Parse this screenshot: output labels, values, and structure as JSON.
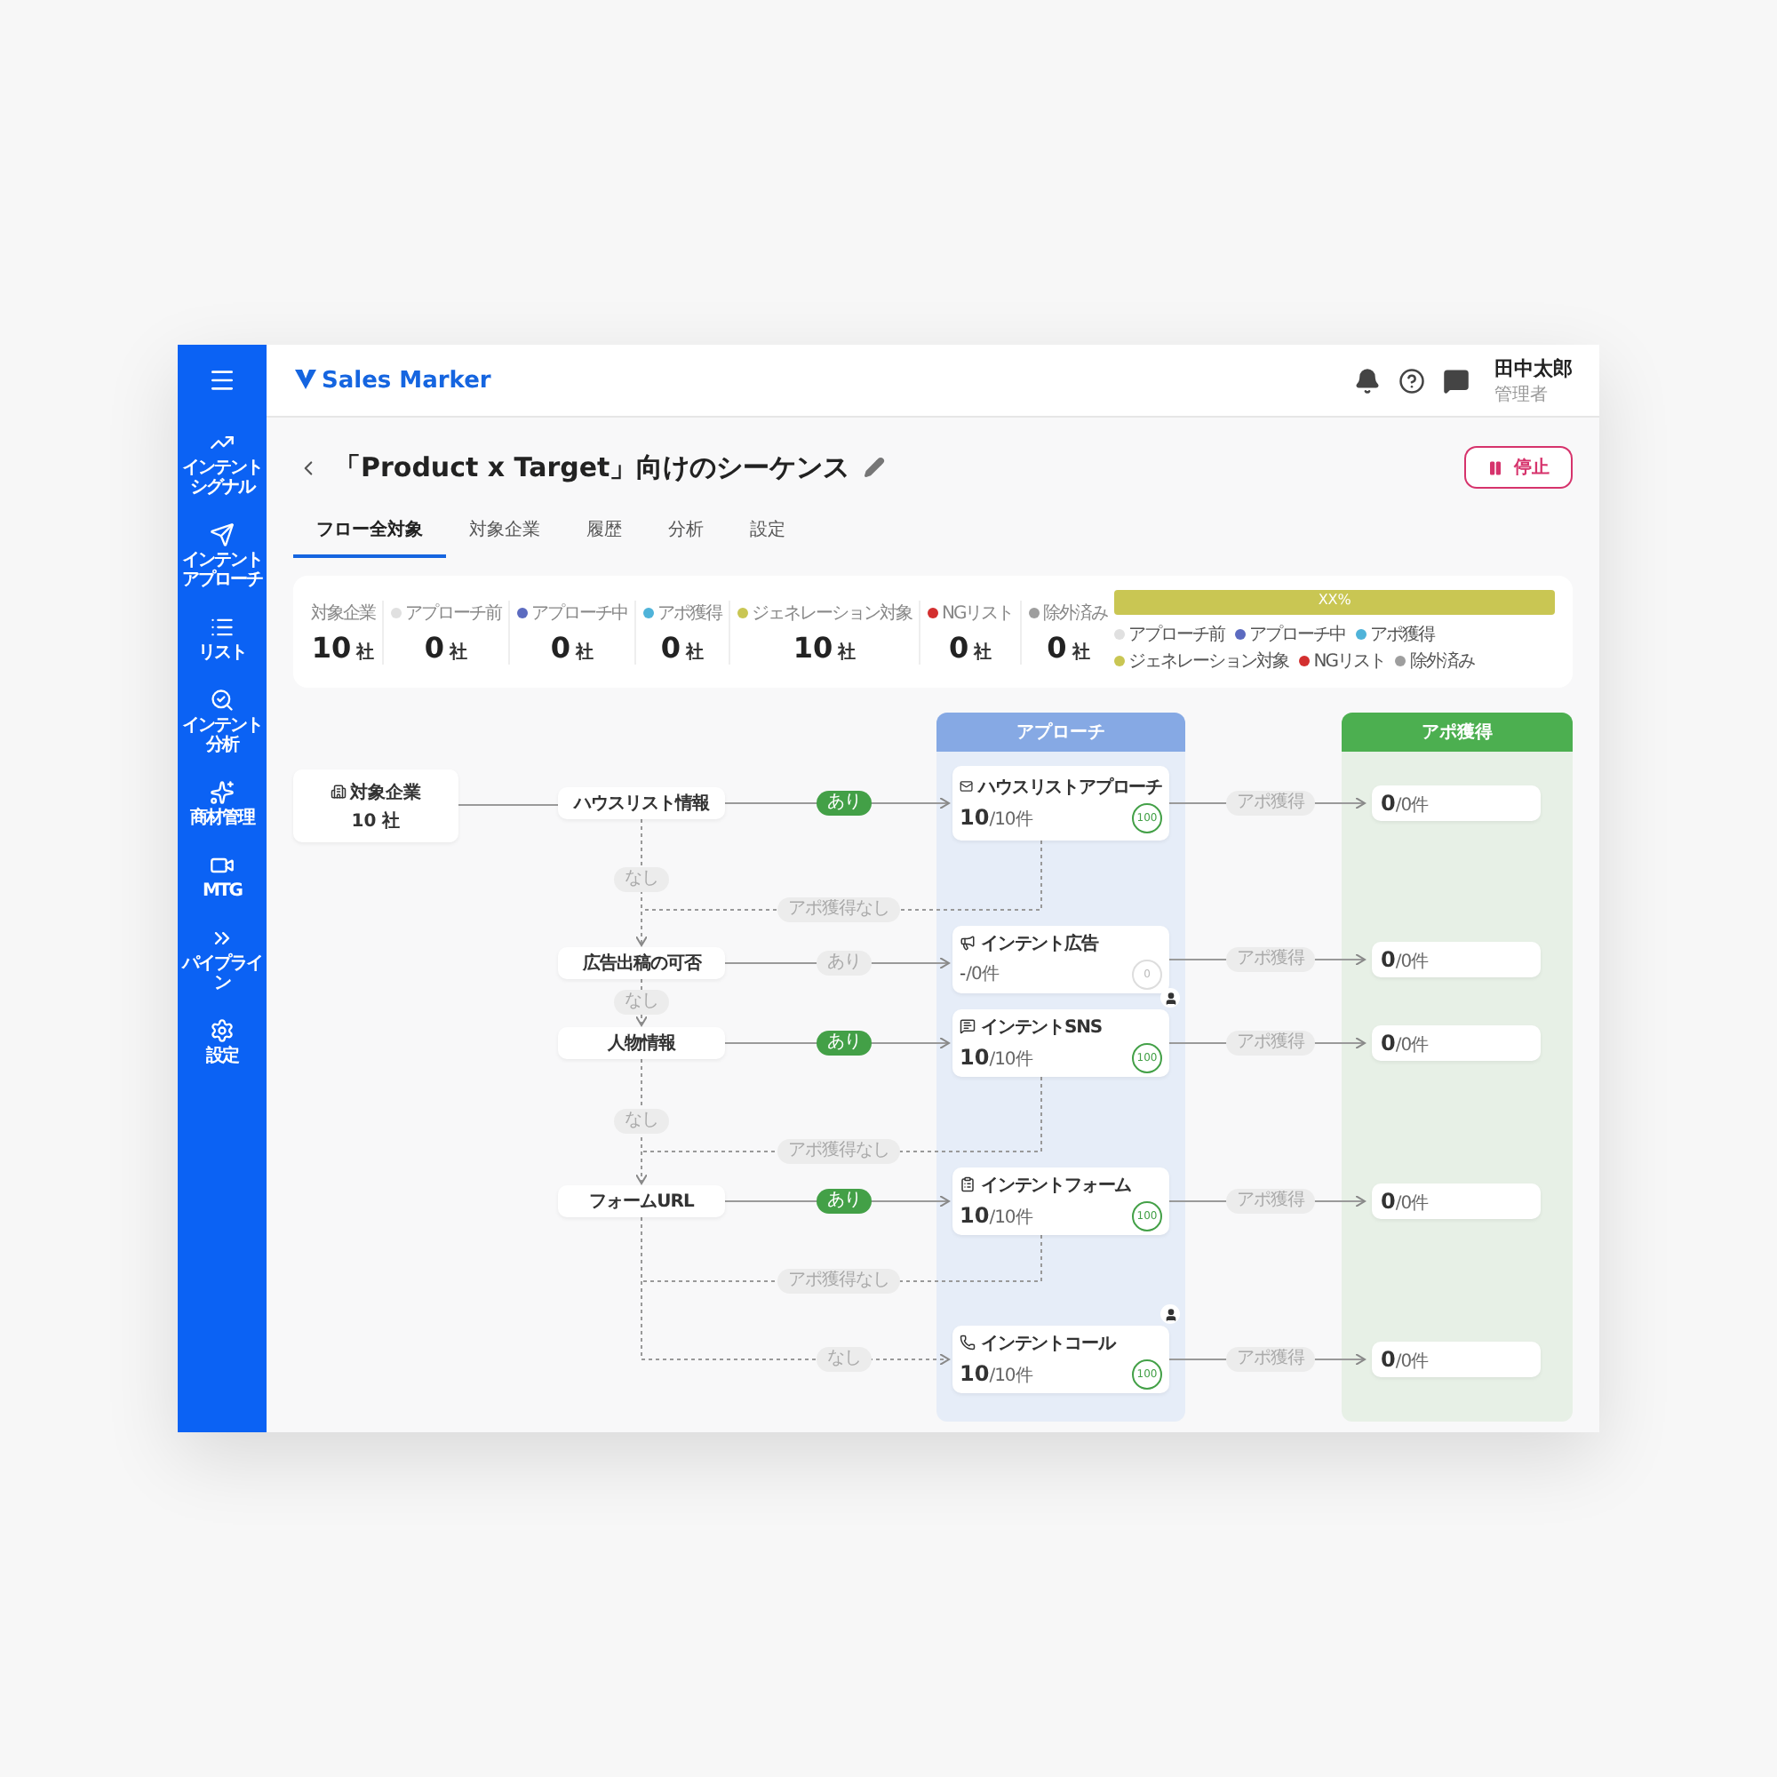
{
  "sidebar": {
    "items": [
      {
        "label": "インテントシグナル"
      },
      {
        "label": "インテントアプローチ"
      },
      {
        "label": "リスト"
      },
      {
        "label": "インテント分析"
      },
      {
        "label": "商材管理"
      },
      {
        "label": "MTG"
      },
      {
        "label": "パイプライン"
      },
      {
        "label": "設定"
      }
    ]
  },
  "header": {
    "logo": "Sales Marker",
    "user": {
      "name": "田中太郎",
      "role": "管理者"
    }
  },
  "page": {
    "title": "「Product x Target」向けのシーケンス",
    "stop_button": "停止"
  },
  "tabs": [
    {
      "label": "フロー全対象",
      "selected": true
    },
    {
      "label": "対象企業",
      "selected": false
    },
    {
      "label": "履歴",
      "selected": false
    },
    {
      "label": "分析",
      "selected": false
    },
    {
      "label": "設定",
      "selected": false
    }
  ],
  "stats": {
    "items": [
      {
        "label": "対象企業",
        "value": "10",
        "unit": "社"
      },
      {
        "label": "アプローチ前",
        "color": "#e0e0e0",
        "value": "0",
        "unit": "社"
      },
      {
        "label": "アプローチ中",
        "color": "#5c6bc0",
        "value": "0",
        "unit": "社"
      },
      {
        "label": "アポ獲得",
        "color": "#4fb3d9",
        "value": "0",
        "unit": "社"
      },
      {
        "label": "ジェネレーション対象",
        "color": "#c9c653",
        "value": "10",
        "unit": "社"
      },
      {
        "label": "NGリスト",
        "color": "#d32f2f",
        "value": "0",
        "unit": "社"
      },
      {
        "label": "除外済み",
        "color": "#9e9e9e",
        "value": "0",
        "unit": "社"
      }
    ],
    "progress": {
      "level": 1,
      "label": "XX%",
      "legend": [
        {
          "label": "アプローチ前",
          "color": "#e0e0e0"
        },
        {
          "label": "アプローチ中",
          "color": "#5c6bc0"
        },
        {
          "label": "アポ獲得",
          "color": "#4fb3d9"
        },
        {
          "label": "ジェネレーション対象",
          "color": "#c9c653"
        },
        {
          "label": "NGリスト",
          "color": "#d32f2f"
        },
        {
          "label": "除外済み",
          "color": "#9e9e9e"
        }
      ]
    }
  },
  "flow": {
    "start": {
      "label": "対象企業",
      "count": "10 社"
    },
    "conditions": [
      {
        "label": "ハウスリスト情報",
        "yes": "あり",
        "active": true,
        "no": "なし"
      },
      {
        "label": "広告出稿の可否",
        "yes": "あり",
        "active": false,
        "no": "なし"
      },
      {
        "label": "人物情報",
        "yes": "あり",
        "active": true,
        "no": "なし"
      },
      {
        "label": "フォームURL",
        "yes": "あり",
        "active": true,
        "no": "なし"
      }
    ],
    "no_appointment": [
      "アポ獲得なし",
      "アポ獲得なし",
      "アポ獲得なし"
    ],
    "approach": {
      "title": "アプローチ",
      "steps": [
        {
          "name": "ハウスリストアプローチ",
          "count": "10",
          "total": "/10件",
          "rate": "100",
          "active": true,
          "assignee": false
        },
        {
          "name": "インテント広告",
          "count": "-",
          "total": "/0件",
          "rate": "0",
          "active": false,
          "assignee": false
        },
        {
          "name": "インテントSNS",
          "count": "10",
          "total": "/10件",
          "rate": "100",
          "active": true,
          "assignee": true
        },
        {
          "name": "インテントフォーム",
          "count": "10",
          "total": "/10件",
          "rate": "100",
          "active": true,
          "assignee": false
        },
        {
          "name": "インテントコール",
          "count": "10",
          "total": "/10件",
          "rate": "100",
          "active": true,
          "assignee": true
        }
      ]
    },
    "appointment": {
      "title": "アポ獲得",
      "results": [
        {
          "pill": "アポ獲得",
          "count": "0",
          "total": "/0件"
        },
        {
          "pill": "アポ獲得",
          "count": "0",
          "total": "/0件"
        },
        {
          "pill": "アポ獲得",
          "count": "0",
          "total": "/0件"
        },
        {
          "pill": "アポ獲得",
          "count": "0",
          "total": "/0件"
        },
        {
          "pill": "アポ獲得",
          "count": "0",
          "total": "/0件"
        }
      ]
    }
  }
}
